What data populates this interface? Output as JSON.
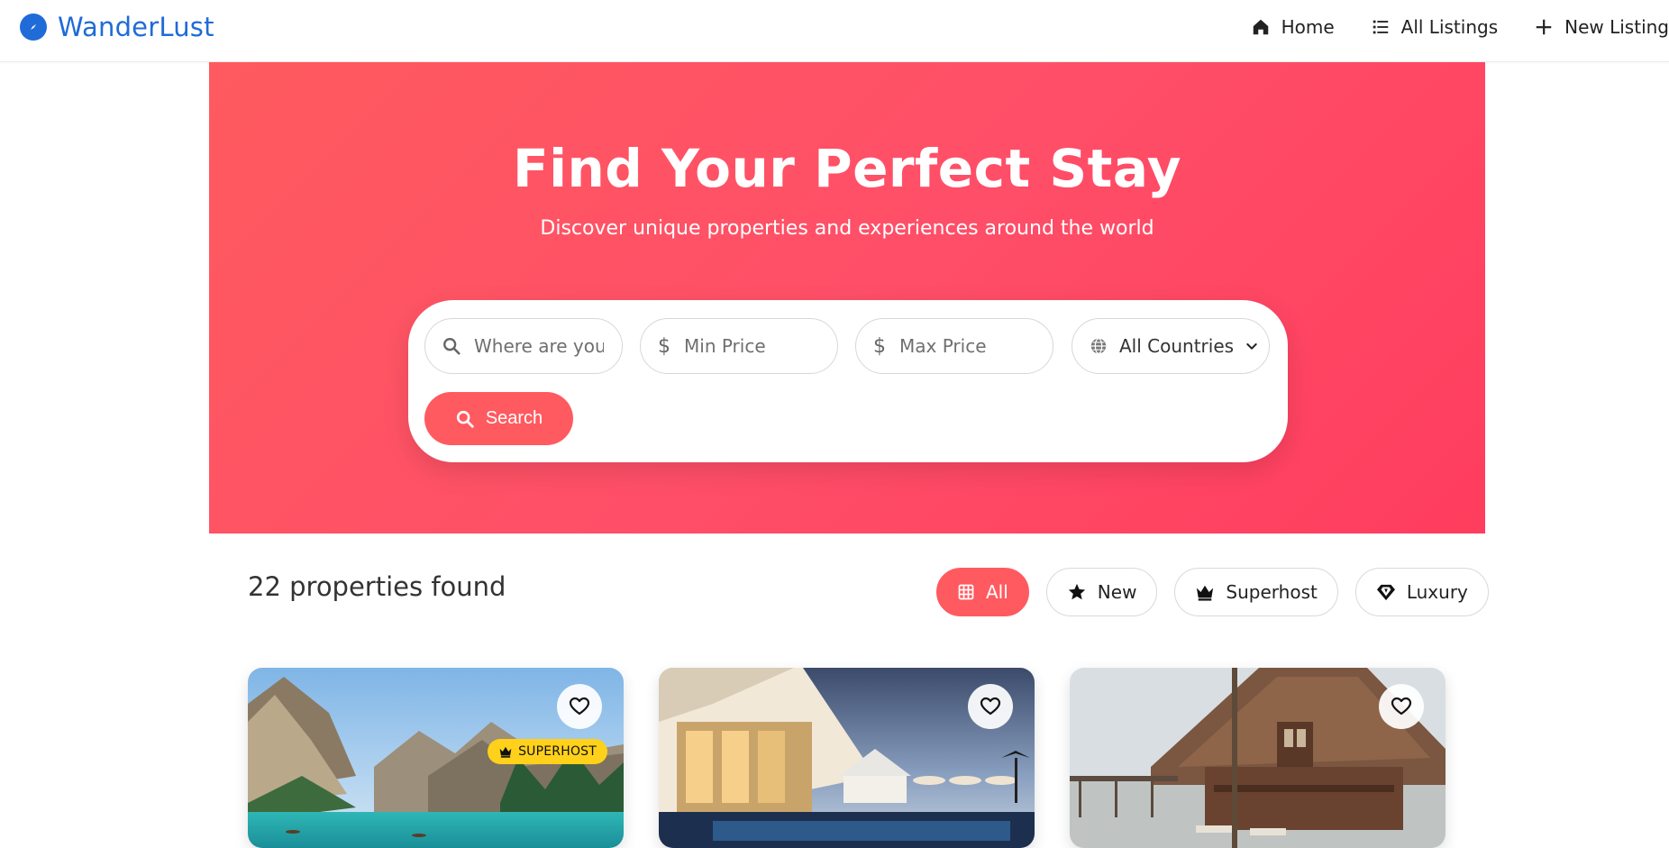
{
  "brand": {
    "name": "WanderLust",
    "icon": "compass-icon",
    "color": "#1f6bd8"
  },
  "nav": {
    "items": [
      {
        "label": "Home",
        "icon": "home-icon"
      },
      {
        "label": "All Listings",
        "icon": "list-icon"
      },
      {
        "label": "New Listing",
        "icon": "plus-icon"
      }
    ]
  },
  "hero": {
    "title": "Find Your Perfect Stay",
    "subtitle": "Discover unique properties and experiences around the world",
    "gradient": [
      "#ff5a5f",
      "#ff3d5e"
    ]
  },
  "search": {
    "location_placeholder": "Where are you going?",
    "min_price_placeholder": "Min Price",
    "max_price_placeholder": "Max Price",
    "country_selected": "All Countries",
    "button_label": "Search",
    "accent": "#ff5a5f"
  },
  "results": {
    "count_text": "22 properties found",
    "filters": [
      {
        "label": "All",
        "icon": "grid-icon",
        "active": true
      },
      {
        "label": "New",
        "icon": "star-icon",
        "active": false
      },
      {
        "label": "Superhost",
        "icon": "crown-icon",
        "active": false
      },
      {
        "label": "Luxury",
        "icon": "diamond-icon",
        "active": false
      }
    ]
  },
  "cards": [
    {
      "scene": "mountain-lake",
      "badge": "SUPERHOST",
      "favorite_icon": "heart-icon"
    },
    {
      "scene": "resort-pool",
      "badge": null,
      "favorite_icon": "heart-icon"
    },
    {
      "scene": "beach-villa",
      "badge": null,
      "favorite_icon": "heart-icon"
    }
  ]
}
